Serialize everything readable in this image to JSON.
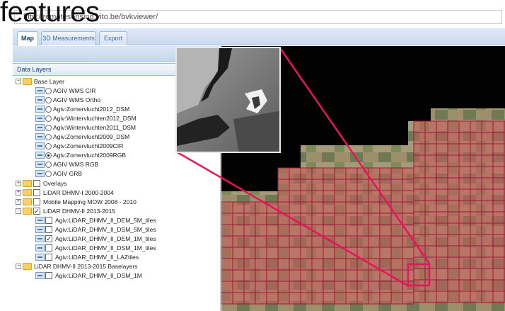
{
  "overlay_title": "features",
  "address_bar": {
    "url": "http://remotesensing.vito.be/bvkviewer/"
  },
  "tabs": [
    {
      "label": "Map",
      "active": true
    },
    {
      "label": "3D Measurements",
      "active": false
    },
    {
      "label": "Export",
      "active": false
    }
  ],
  "panel": {
    "title": "Data Layers"
  },
  "tree": {
    "base_layer": "Base Layer",
    "base_items": [
      {
        "label": "AGIV WMS CIR",
        "selected": false
      },
      {
        "label": "AGIV WMS Ortho",
        "selected": false
      },
      {
        "label": "Agiv:Zomervlucht2012_DSM",
        "selected": false
      },
      {
        "label": "Agiv:Wintervluchten2012_DSM",
        "selected": false
      },
      {
        "label": "Agiv:Wintervluchten2011_DSM",
        "selected": false
      },
      {
        "label": "Agiv:Zomervlucht2009_DSM",
        "selected": false
      },
      {
        "label": "Agiv:Zomervlucht2009CIR",
        "selected": false
      },
      {
        "label": "Agiv:Zomervlucht2009RGB",
        "selected": true
      },
      {
        "label": "AGIV WMS RGB",
        "selected": false
      },
      {
        "label": "AGIV GRB",
        "selected": false
      }
    ],
    "groups": [
      {
        "label": "Overlays",
        "checked": false
      },
      {
        "label": "LiDAR DHMV-I 2000-2004",
        "checked": false
      },
      {
        "label": "Mobile Mapping MOW 2008 - 2010",
        "checked": false
      },
      {
        "label": "LiDAR DHMV-II 2013-2015",
        "checked": true
      }
    ],
    "lidar_items": [
      {
        "label": "Agiv:LiDAR_DHMV_II_DEM_5M_tiles",
        "checked": false
      },
      {
        "label": "Agiv:LiDAR_DHMV_II_DSM_5M_tiles",
        "checked": false
      },
      {
        "label": "Agiv:LiDAR_DHMV_II_DEM_1M_tiles",
        "checked": true
      },
      {
        "label": "Agiv:LiDAR_DHMV_II_DSM_1M_tiles",
        "checked": false
      },
      {
        "label": "Agiv:LiDAR_DHMV_II_LAZtiles",
        "checked": false
      }
    ],
    "baselayers_group": "LiDAR DHMV-II 2013-2015 Baselayers",
    "baselayers_items": [
      {
        "label": "Agiv:LiDAR_DHMV_II_DSM_1M",
        "checked": false
      }
    ]
  },
  "colors": {
    "tile_fill": "#c85a5a",
    "tile_stroke": "#a2163c",
    "highlight": "#e8145a",
    "panel_header": "#15428b"
  }
}
